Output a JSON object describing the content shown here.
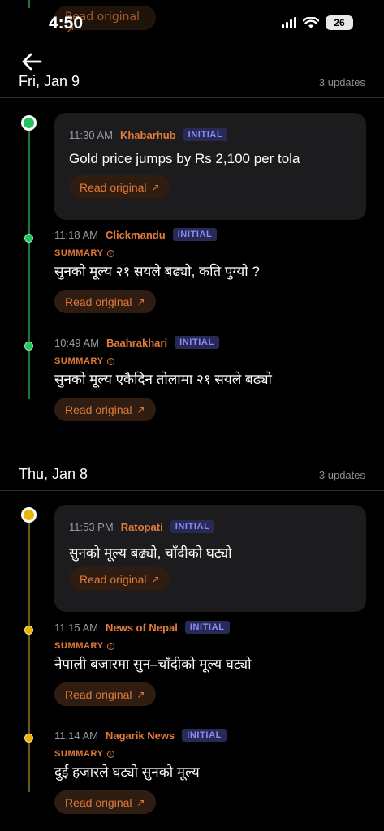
{
  "status_bar": {
    "time": "4:50",
    "battery": "26"
  },
  "peek": {
    "read_label": "Read original ↗"
  },
  "days": [
    {
      "title": "Fri, Jan 9",
      "count": "3 updates",
      "items": [
        {
          "time": "11:30 AM",
          "source": "Khabarhub",
          "badge": "INITIAL",
          "summary": "",
          "headline": "Gold price jumps by Rs 2,100 per tola",
          "read": "Read original"
        },
        {
          "time": "11:18 AM",
          "source": "Clickmandu",
          "badge": "INITIAL",
          "summary": "SUMMARY",
          "headline": "सुनको मूल्य २१ सयले बढ्यो, कति पुग्यो ?",
          "read": "Read original"
        },
        {
          "time": "10:49 AM",
          "source": "Baahrakhari",
          "badge": "INITIAL",
          "summary": "SUMMARY",
          "headline": "सुनको मूल्य एकैदिन तोलामा २१ सयले बढ्यो",
          "read": "Read original"
        }
      ]
    },
    {
      "title": "Thu, Jan 8",
      "count": "3 updates",
      "items": [
        {
          "time": "11:53 PM",
          "source": "Ratopati",
          "badge": "INITIAL",
          "summary": "",
          "headline": "सुनको मूल्य बढ्यो, चाँदीको घट्यो",
          "read": "Read original"
        },
        {
          "time": "11:15 AM",
          "source": "News of Nepal",
          "badge": "INITIAL",
          "summary": "SUMMARY",
          "headline": "नेपाली बजारमा सुन–चाँदीको मूल्य घट्यो",
          "read": "Read original"
        },
        {
          "time": "11:14 AM",
          "source": "Nagarik News",
          "badge": "INITIAL",
          "summary": "SUMMARY",
          "headline": "दुई हजारले घट्यो सुनको मूल्य",
          "read": "Read original"
        }
      ]
    }
  ],
  "colors": {
    "accent": "#e0793a",
    "timeline_fri": "#22c55e",
    "timeline_thu": "#eab308",
    "badge_text": "#8b8cf5"
  },
  "icons": {
    "back": "arrow-left-icon",
    "external": "arrow-up-right-icon",
    "info": "info-icon"
  }
}
